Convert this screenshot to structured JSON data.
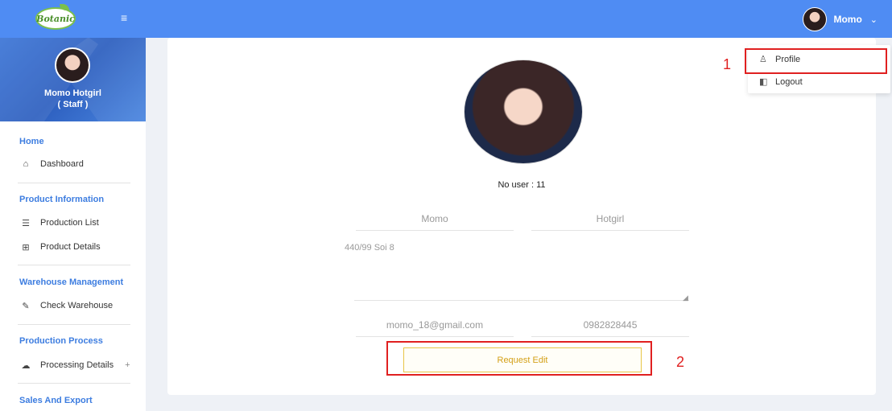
{
  "app": {
    "logo_text": "Botanic",
    "hamburger_icon": "menu-icon"
  },
  "topbar": {
    "user_name": "Momo",
    "caret": "⌄"
  },
  "sidebar": {
    "profile_name": "Momo Hotgirl",
    "profile_role": "( Staff )",
    "sections": [
      {
        "title": "Home",
        "items": [
          {
            "label": "Dashboard",
            "icon": "home-icon"
          }
        ]
      },
      {
        "title": "Product Information",
        "items": [
          {
            "label": "Production List",
            "icon": "list-icon"
          },
          {
            "label": "Product Details",
            "icon": "grid-icon"
          }
        ]
      },
      {
        "title": "Warehouse Management",
        "items": [
          {
            "label": "Check Warehouse",
            "icon": "edit-icon"
          }
        ]
      },
      {
        "title": "Production Process",
        "items": [
          {
            "label": "Processing Details",
            "icon": "cloud-icon",
            "expand": "+"
          }
        ]
      },
      {
        "title": "Sales And Export",
        "items": []
      }
    ]
  },
  "profile_form": {
    "no_user_label": "No user : 11",
    "first_name": "Momo",
    "last_name": "Hotgirl",
    "address": "440/99 Soi 8",
    "email": "momo_18@gmail.com",
    "phone": "0982828445",
    "request_button": "Request Edit"
  },
  "dropdown": {
    "items": [
      {
        "label": "Profile",
        "icon": "user-icon"
      },
      {
        "label": "Logout",
        "icon": "logout-icon"
      }
    ]
  },
  "annotations": {
    "n1": "1",
    "n2": "2"
  },
  "colors": {
    "topbar": "#4f8cf3",
    "accent": "#3d7de0",
    "annotation": "#e02020",
    "button_border": "#e8c547"
  }
}
